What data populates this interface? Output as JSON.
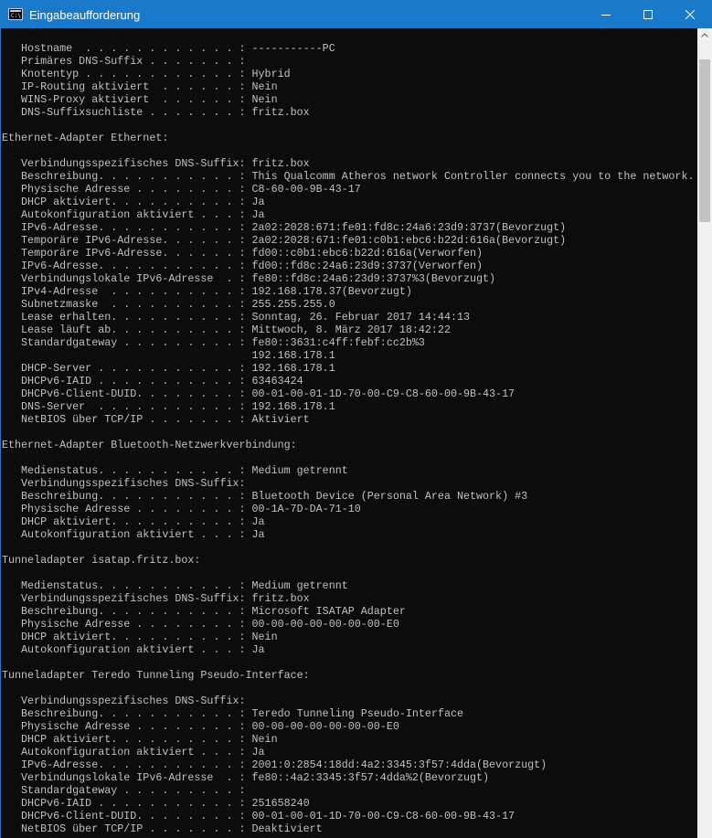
{
  "window": {
    "title": "Eingabeaufforderung"
  },
  "icons": {
    "app": "cmd-icon",
    "minimize": "minimize-icon",
    "maximize": "maximize-icon",
    "close": "close-icon",
    "scroll_up": "chevron-up-icon"
  },
  "colors": {
    "titlebar": "#1979ca",
    "console_background": "#0c0c0c",
    "console_text": "#c0c0c0",
    "scrollbar_track": "#f0f0f0",
    "scrollbar_thumb": "#c2c2c2"
  },
  "scrollbar": {
    "position_fraction": 0.0
  },
  "console": {
    "lines": [
      "   Hostname  . . . . . . . . . . . . : ‐‐‐‐‐‐‐‐‐‐-PC",
      "   Primäres DNS-Suffix . . . . . . . : ",
      "   Knotentyp . . . . . . . . . . . . : Hybrid",
      "   IP-Routing aktiviert  . . . . . . : Nein",
      "   WINS-Proxy aktiviert  . . . . . . : Nein",
      "   DNS-Suffixsuchliste . . . . . . . : fritz.box",
      "",
      "Ethernet-Adapter Ethernet:",
      "",
      "   Verbindungsspezifisches DNS-Suffix: fritz.box",
      "   Beschreibung. . . . . . . . . . . : This Qualcomm Atheros network Controller connects you to the network.",
      "   Physische Adresse . . . . . . . . : C8-60-00-9B-43-17",
      "   DHCP aktiviert. . . . . . . . . . : Ja",
      "   Autokonfiguration aktiviert . . . : Ja",
      "   IPv6-Adresse. . . . . . . . . . . : 2a02:2028:671:fe01:fd8c:24a6:23d9:3737(Bevorzugt)",
      "   Temporäre IPv6-Adresse. . . . . . : 2a02:2028:671:fe01:c0b1:ebc6:b22d:616a(Bevorzugt)",
      "   Temporäre IPv6-Adresse. . . . . . : fd00::c0b1:ebc6:b22d:616a(Verworfen)",
      "   IPv6-Adresse. . . . . . . . . . . : fd00::fd8c:24a6:23d9:3737(Verworfen)",
      "   Verbindungslokale IPv6-Adresse  . : fe80::fd8c:24a6:23d9:3737%3(Bevorzugt)",
      "   IPv4-Adresse  . . . . . . . . . . : 192.168.178.37(Bevorzugt)",
      "   Subnetzmaske  . . . . . . . . . . : 255.255.255.0",
      "   Lease erhalten. . . . . . . . . . : Sonntag, 26. Februar 2017 14:44:13",
      "   Lease läuft ab. . . . . . . . . . : Mittwoch, 8. März 2017 18:42:22",
      "   Standardgateway . . . . . . . . . : fe80::3631:c4ff:febf:cc2b%3",
      "                                       192.168.178.1",
      "   DHCP-Server . . . . . . . . . . . : 192.168.178.1",
      "   DHCPv6-IAID . . . . . . . . . . . : 63463424",
      "   DHCPv6-Client-DUID. . . . . . . . : 00-01-00-01-1D-70-00-C9-C8-60-00-9B-43-17",
      "   DNS-Server  . . . . . . . . . . . : 192.168.178.1",
      "   NetBIOS über TCP/IP . . . . . . . : Aktiviert",
      "",
      "Ethernet-Adapter Bluetooth-Netzwerkverbindung:",
      "",
      "   Medienstatus. . . . . . . . . . . : Medium getrennt",
      "   Verbindungsspezifisches DNS-Suffix: ",
      "   Beschreibung. . . . . . . . . . . : Bluetooth Device (Personal Area Network) #3",
      "   Physische Adresse . . . . . . . . : 00-1A-7D-DA-71-10",
      "   DHCP aktiviert. . . . . . . . . . : Ja",
      "   Autokonfiguration aktiviert . . . : Ja",
      "",
      "Tunneladapter isatap.fritz.box:",
      "",
      "   Medienstatus. . . . . . . . . . . : Medium getrennt",
      "   Verbindungsspezifisches DNS-Suffix: fritz.box",
      "   Beschreibung. . . . . . . . . . . : Microsoft ISATAP Adapter",
      "   Physische Adresse . . . . . . . . : 00-00-00-00-00-00-00-E0",
      "   DHCP aktiviert. . . . . . . . . . : Nein",
      "   Autokonfiguration aktiviert . . . : Ja",
      "",
      "Tunneladapter Teredo Tunneling Pseudo-Interface:",
      "",
      "   Verbindungsspezifisches DNS-Suffix: ",
      "   Beschreibung. . . . . . . . . . . : Teredo Tunneling Pseudo-Interface",
      "   Physische Adresse . . . . . . . . : 00-00-00-00-00-00-00-E0",
      "   DHCP aktiviert. . . . . . . . . . : Nein",
      "   Autokonfiguration aktiviert . . . : Ja",
      "   IPv6-Adresse. . . . . . . . . . . : 2001:0:2854:18dd:4a2:3345:3f57:4dda(Bevorzugt)",
      "   Verbindungslokale IPv6-Adresse  . : fe80::4a2:3345:3f57:4dda%2(Bevorzugt)",
      "   Standardgateway . . . . . . . . . : ",
      "   DHCPv6-IAID . . . . . . . . . . . : 251658240",
      "   DHCPv6-Client-DUID. . . . . . . . : 00-01-00-01-1D-70-00-C9-C8-60-00-9B-43-17",
      "   NetBIOS über TCP/IP . . . . . . . : Deaktiviert"
    ]
  }
}
